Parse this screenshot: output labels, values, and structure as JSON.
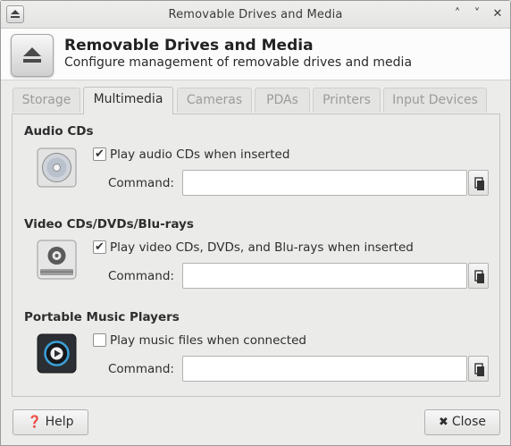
{
  "window": {
    "title": "Removable Drives and Media",
    "controls": {
      "shade": "˄",
      "minimize": "˅",
      "close": "✕"
    }
  },
  "header": {
    "title": "Removable Drives and Media",
    "subtitle": "Configure management of removable drives and media",
    "icon": "eject-icon"
  },
  "tabs": [
    {
      "label": "Storage",
      "active": false
    },
    {
      "label": "Multimedia",
      "active": true
    },
    {
      "label": "Cameras",
      "active": false
    },
    {
      "label": "PDAs",
      "active": false
    },
    {
      "label": "Printers",
      "active": false
    },
    {
      "label": "Input Devices",
      "active": false
    }
  ],
  "sections": [
    {
      "title": "Audio CDs",
      "icon": "audio-cd-icon",
      "checkbox_label": "Play audio CDs when inserted",
      "checked": true,
      "command_label": "Command:",
      "command_value": ""
    },
    {
      "title": "Video CDs/DVDs/Blu-rays",
      "icon": "optical-drive-icon",
      "checkbox_label": "Play video CDs, DVDs, and Blu-rays when inserted",
      "checked": true,
      "command_label": "Command:",
      "command_value": ""
    },
    {
      "title": "Portable Music Players",
      "icon": "music-player-icon",
      "checkbox_label": "Play music files when connected",
      "checked": false,
      "command_label": "Command:",
      "command_value": ""
    }
  ],
  "footer": {
    "help_label": "Help",
    "close_label": "Close"
  }
}
